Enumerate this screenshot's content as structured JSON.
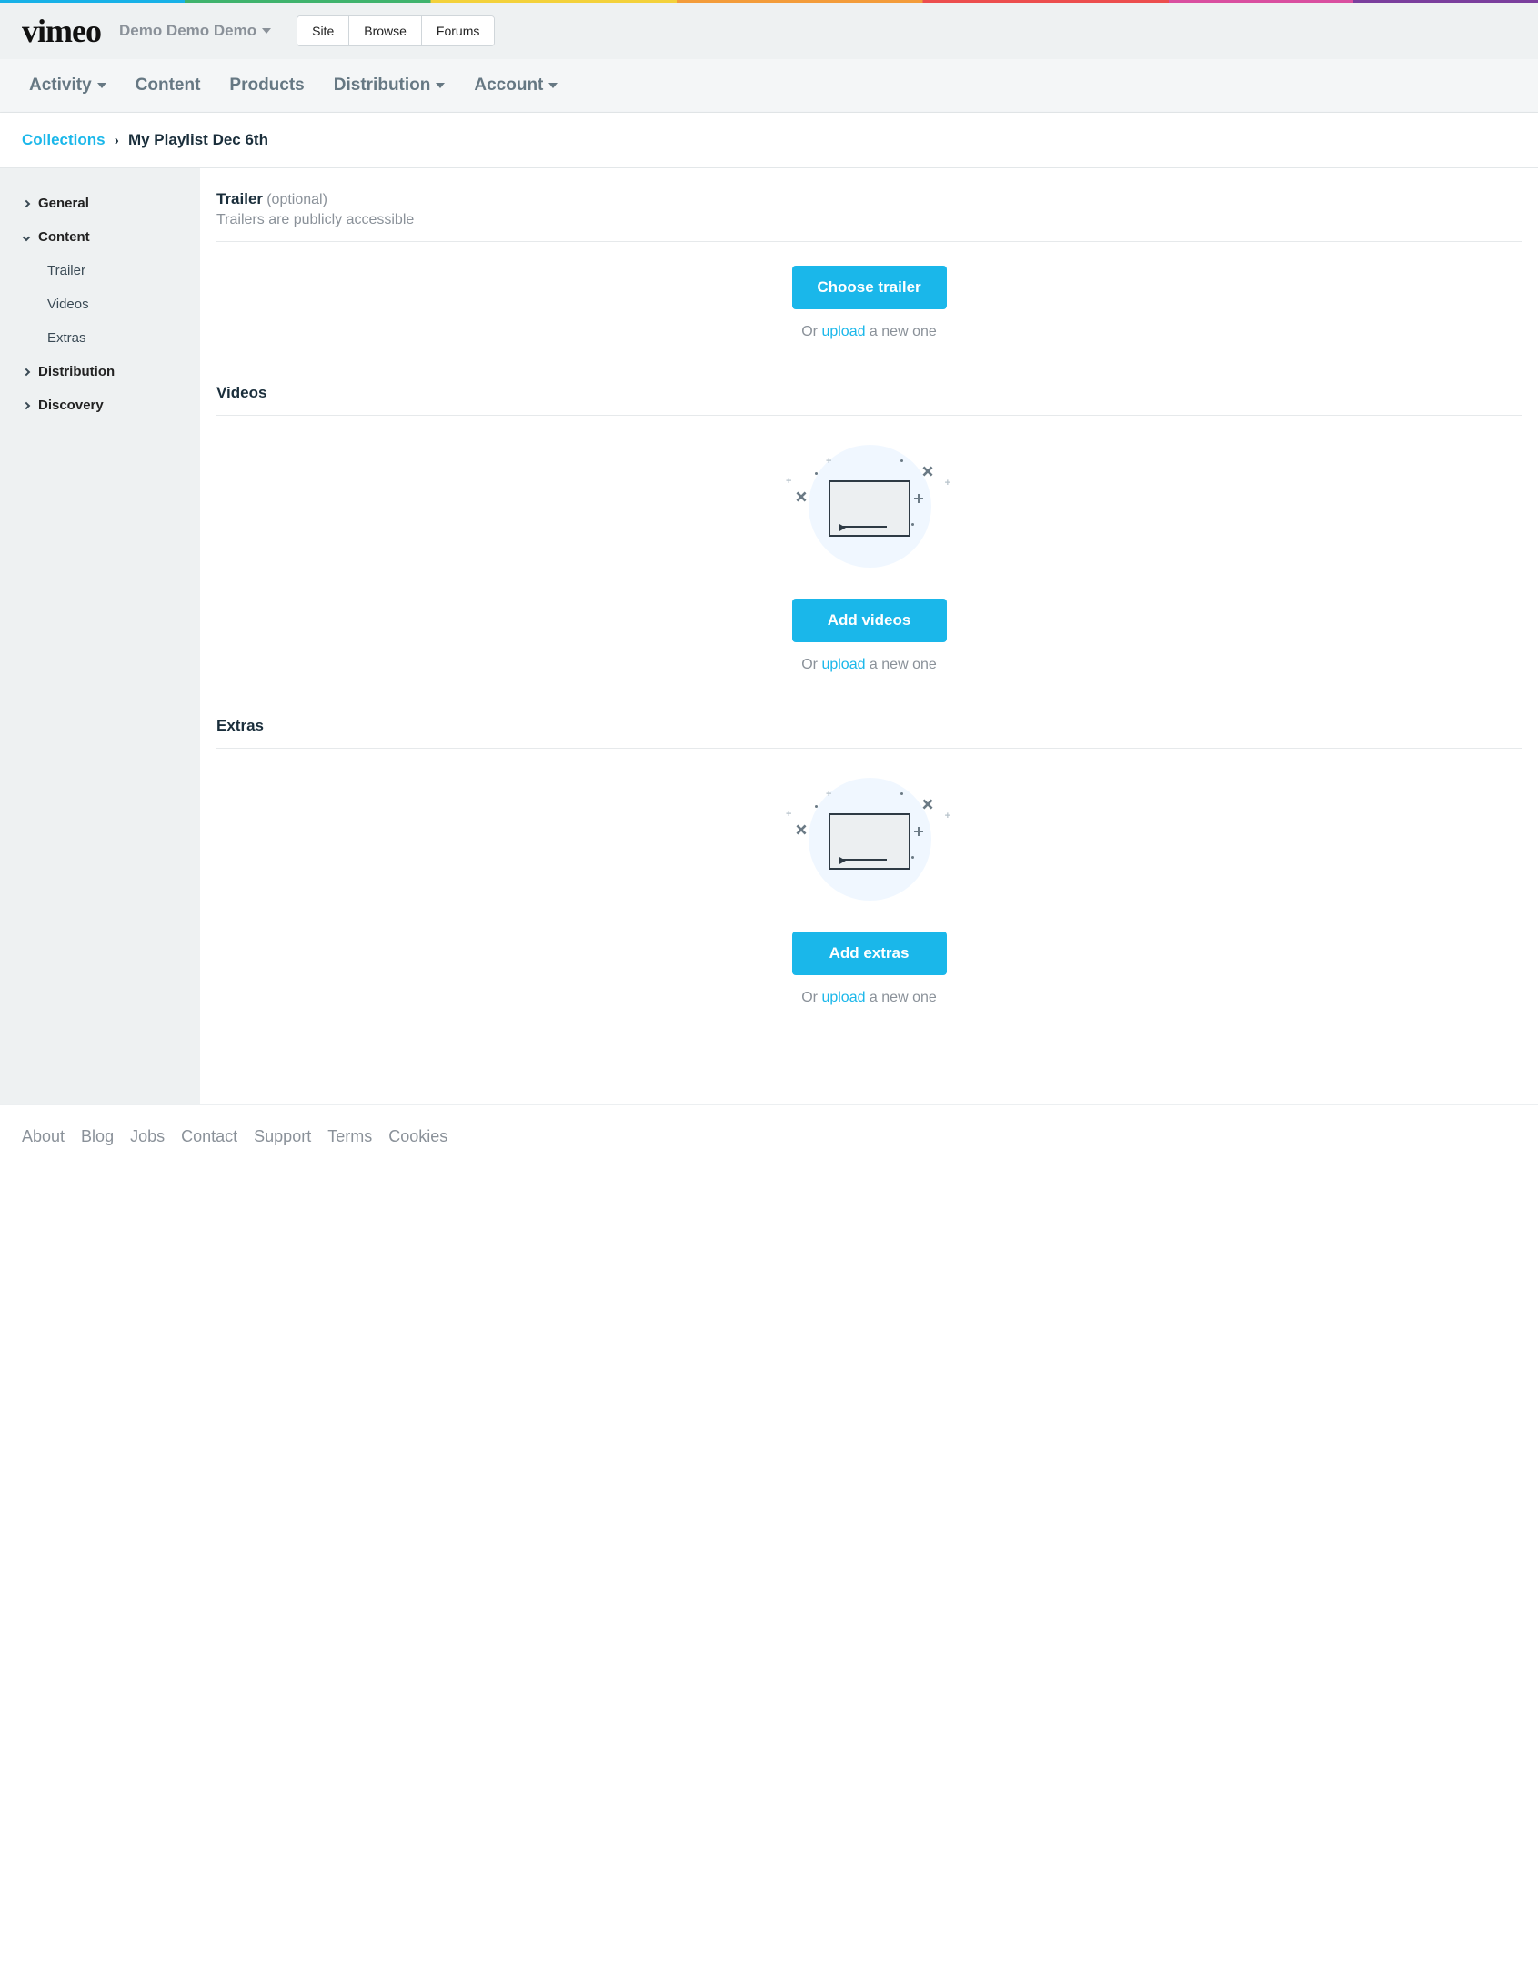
{
  "topbar": {
    "site_dropdown": "Demo Demo Demo",
    "buttons": {
      "site": "Site",
      "browse": "Browse",
      "forums": "Forums"
    }
  },
  "nav": {
    "activity": "Activity",
    "content": "Content",
    "products": "Products",
    "distribution": "Distribution",
    "account": "Account"
  },
  "breadcrumb": {
    "collections": "Collections",
    "current": "My Playlist Dec 6th"
  },
  "sidebar": {
    "general": "General",
    "content": "Content",
    "content_children": {
      "trailer": "Trailer",
      "videos": "Videos",
      "extras": "Extras"
    },
    "distribution": "Distribution",
    "discovery": "Discovery"
  },
  "sections": {
    "trailer": {
      "title": "Trailer",
      "optional": "(optional)",
      "sub": "Trailers are publicly accessible",
      "button": "Choose trailer",
      "or_prefix": "Or ",
      "upload": "upload",
      "or_suffix": " a new one"
    },
    "videos": {
      "title": "Videos",
      "button": "Add videos",
      "or_prefix": "Or ",
      "upload": "upload",
      "or_suffix": " a new one"
    },
    "extras": {
      "title": "Extras",
      "button": "Add extras",
      "or_prefix": "Or ",
      "upload": "upload",
      "or_suffix": " a new one"
    }
  },
  "footer": {
    "about": "About",
    "blog": "Blog",
    "jobs": "Jobs",
    "contact": "Contact",
    "support": "Support",
    "terms": "Terms",
    "cookies": "Cookies"
  }
}
